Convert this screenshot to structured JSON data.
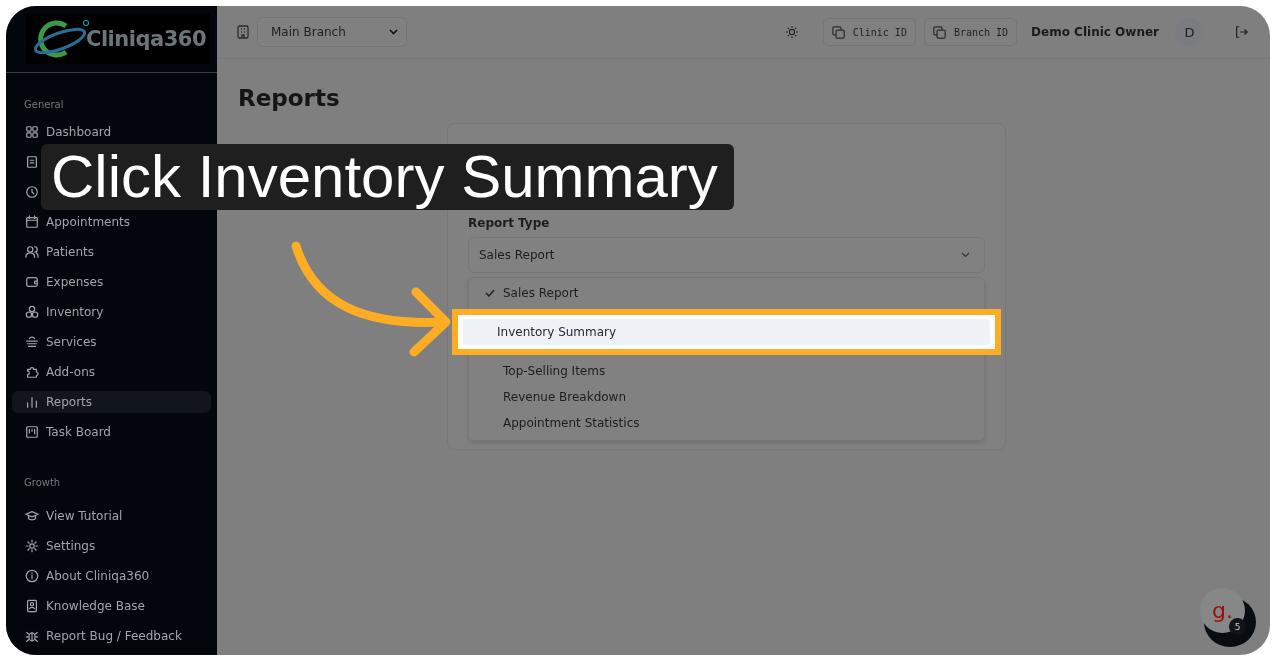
{
  "sidebar": {
    "logo_text": "Cliniqa360",
    "sections": [
      {
        "title": "General",
        "items": [
          {
            "kind": "grid",
            "label": "Dashboard",
            "selected": false
          },
          {
            "kind": "receipt",
            "selected": false
          },
          {
            "kind": "history",
            "selected": false
          },
          {
            "kind": "calendar",
            "label": "Appointments",
            "selected": false
          },
          {
            "kind": "users",
            "label": "Patients",
            "selected": false
          },
          {
            "kind": "wallet",
            "label": "Expenses",
            "selected": false
          },
          {
            "kind": "boxes",
            "label": "Inventory",
            "selected": false
          },
          {
            "kind": "layers",
            "label": "Services",
            "selected": false
          },
          {
            "kind": "puzzle",
            "label": "Add-ons",
            "selected": false
          },
          {
            "kind": "chart",
            "label": "Reports",
            "selected": true
          },
          {
            "kind": "board",
            "label": "Task Board",
            "selected": false
          }
        ]
      },
      {
        "title": "Growth"
      }
    ],
    "footer_items": [
      {
        "kind": "cap",
        "label": "View Tutorial",
        "selected": false
      },
      {
        "kind": "gear",
        "label": "Settings",
        "selected": false
      },
      {
        "kind": "info",
        "label": "About Cliniqa360",
        "selected": false
      },
      {
        "kind": "book",
        "label": "Knowledge Base",
        "selected": false
      },
      {
        "kind": "bug",
        "label": "Report Bug / Feedback",
        "selected": false
      }
    ]
  },
  "topbar": {
    "branch_select": "Main Branch",
    "clinic_id_button": "Clinic ID",
    "branch_id_button": "Branch ID",
    "user_name": "Demo Clinic Owner",
    "avatar_initial": "D"
  },
  "page": {
    "title": "Reports",
    "card": {
      "report_type_label": "Report Type",
      "report_type_value": "Sales Report",
      "options": [
        {
          "label": "Sales Report",
          "checked": true,
          "highlighted": false
        },
        {
          "label": "Inventory Summary",
          "checked": false,
          "highlighted": true
        },
        {
          "label": "Top-Selling Items",
          "checked": false,
          "highlighted": false
        },
        {
          "label": "Revenue Breakdown",
          "checked": false,
          "highlighted": false
        },
        {
          "label": "Appointment Statistics",
          "checked": false,
          "highlighted": false
        }
      ]
    }
  },
  "tutorial_caption": "Click Inventory Summary",
  "help_widget": {
    "logo": "g.",
    "badge": "5"
  }
}
